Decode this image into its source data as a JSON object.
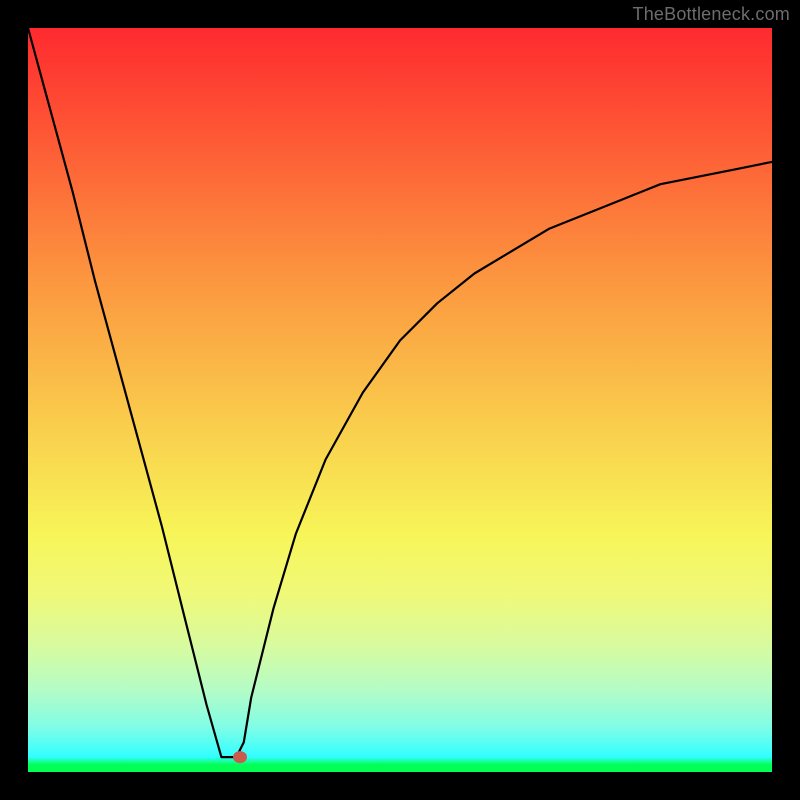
{
  "watermark": "TheBottleneck.com",
  "colors": {
    "frame": "#000000",
    "curve": "#000000",
    "marker": "#c85a4e",
    "gradient_top": "#fe2a2f",
    "gradient_bottom": "#02ff55"
  },
  "chart_data": {
    "type": "line",
    "title": "",
    "xlabel": "",
    "ylabel": "",
    "xlim": [
      0,
      100
    ],
    "ylim": [
      0,
      100
    ],
    "notes": "V-shaped bottleneck curve on a red-to-green vertical gradient. No axis ticks or labels visible. A single marker dot sits near the minimum. Values below are visually estimated from the plotted curve (x as 0–100 across width, y as 0–100 with 0 at bottom).",
    "x": [
      0,
      3,
      6,
      9,
      12,
      15,
      18,
      21,
      24,
      26,
      27,
      28,
      29,
      30,
      33,
      36,
      40,
      45,
      50,
      55,
      60,
      65,
      70,
      75,
      80,
      85,
      90,
      95,
      100
    ],
    "values": [
      100,
      89,
      78,
      66,
      55,
      44,
      33,
      21,
      9,
      2,
      2,
      2,
      4,
      10,
      22,
      32,
      42,
      51,
      58,
      63,
      67,
      70,
      73,
      75,
      77,
      79,
      80,
      81,
      82
    ],
    "marker": {
      "x": 28.5,
      "y": 2
    }
  }
}
